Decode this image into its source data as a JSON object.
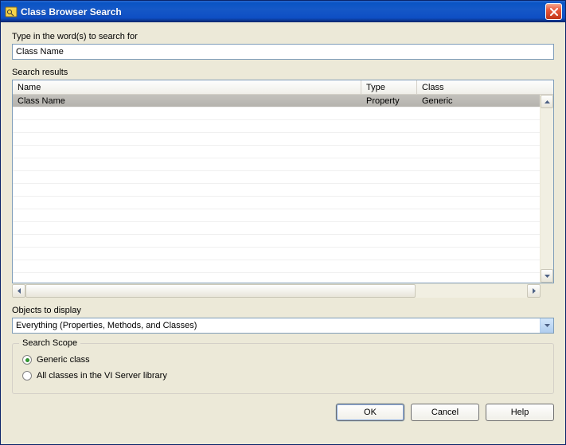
{
  "window": {
    "title": "Class Browser Search"
  },
  "search": {
    "label": "Type in the word(s) to search for",
    "value": "Class Name"
  },
  "results": {
    "label": "Search results",
    "columns": {
      "name": "Name",
      "type": "Type",
      "class": "Class"
    },
    "rows": [
      {
        "name": "Class Name",
        "type": "Property",
        "class": "Generic"
      }
    ]
  },
  "display": {
    "label": "Objects to display",
    "value": "Everything (Properties, Methods, and Classes)"
  },
  "scope": {
    "title": "Search Scope",
    "generic": "Generic class",
    "all": "All classes in the VI Server library",
    "selected": "generic"
  },
  "buttons": {
    "ok": "OK",
    "cancel": "Cancel",
    "help": "Help"
  }
}
